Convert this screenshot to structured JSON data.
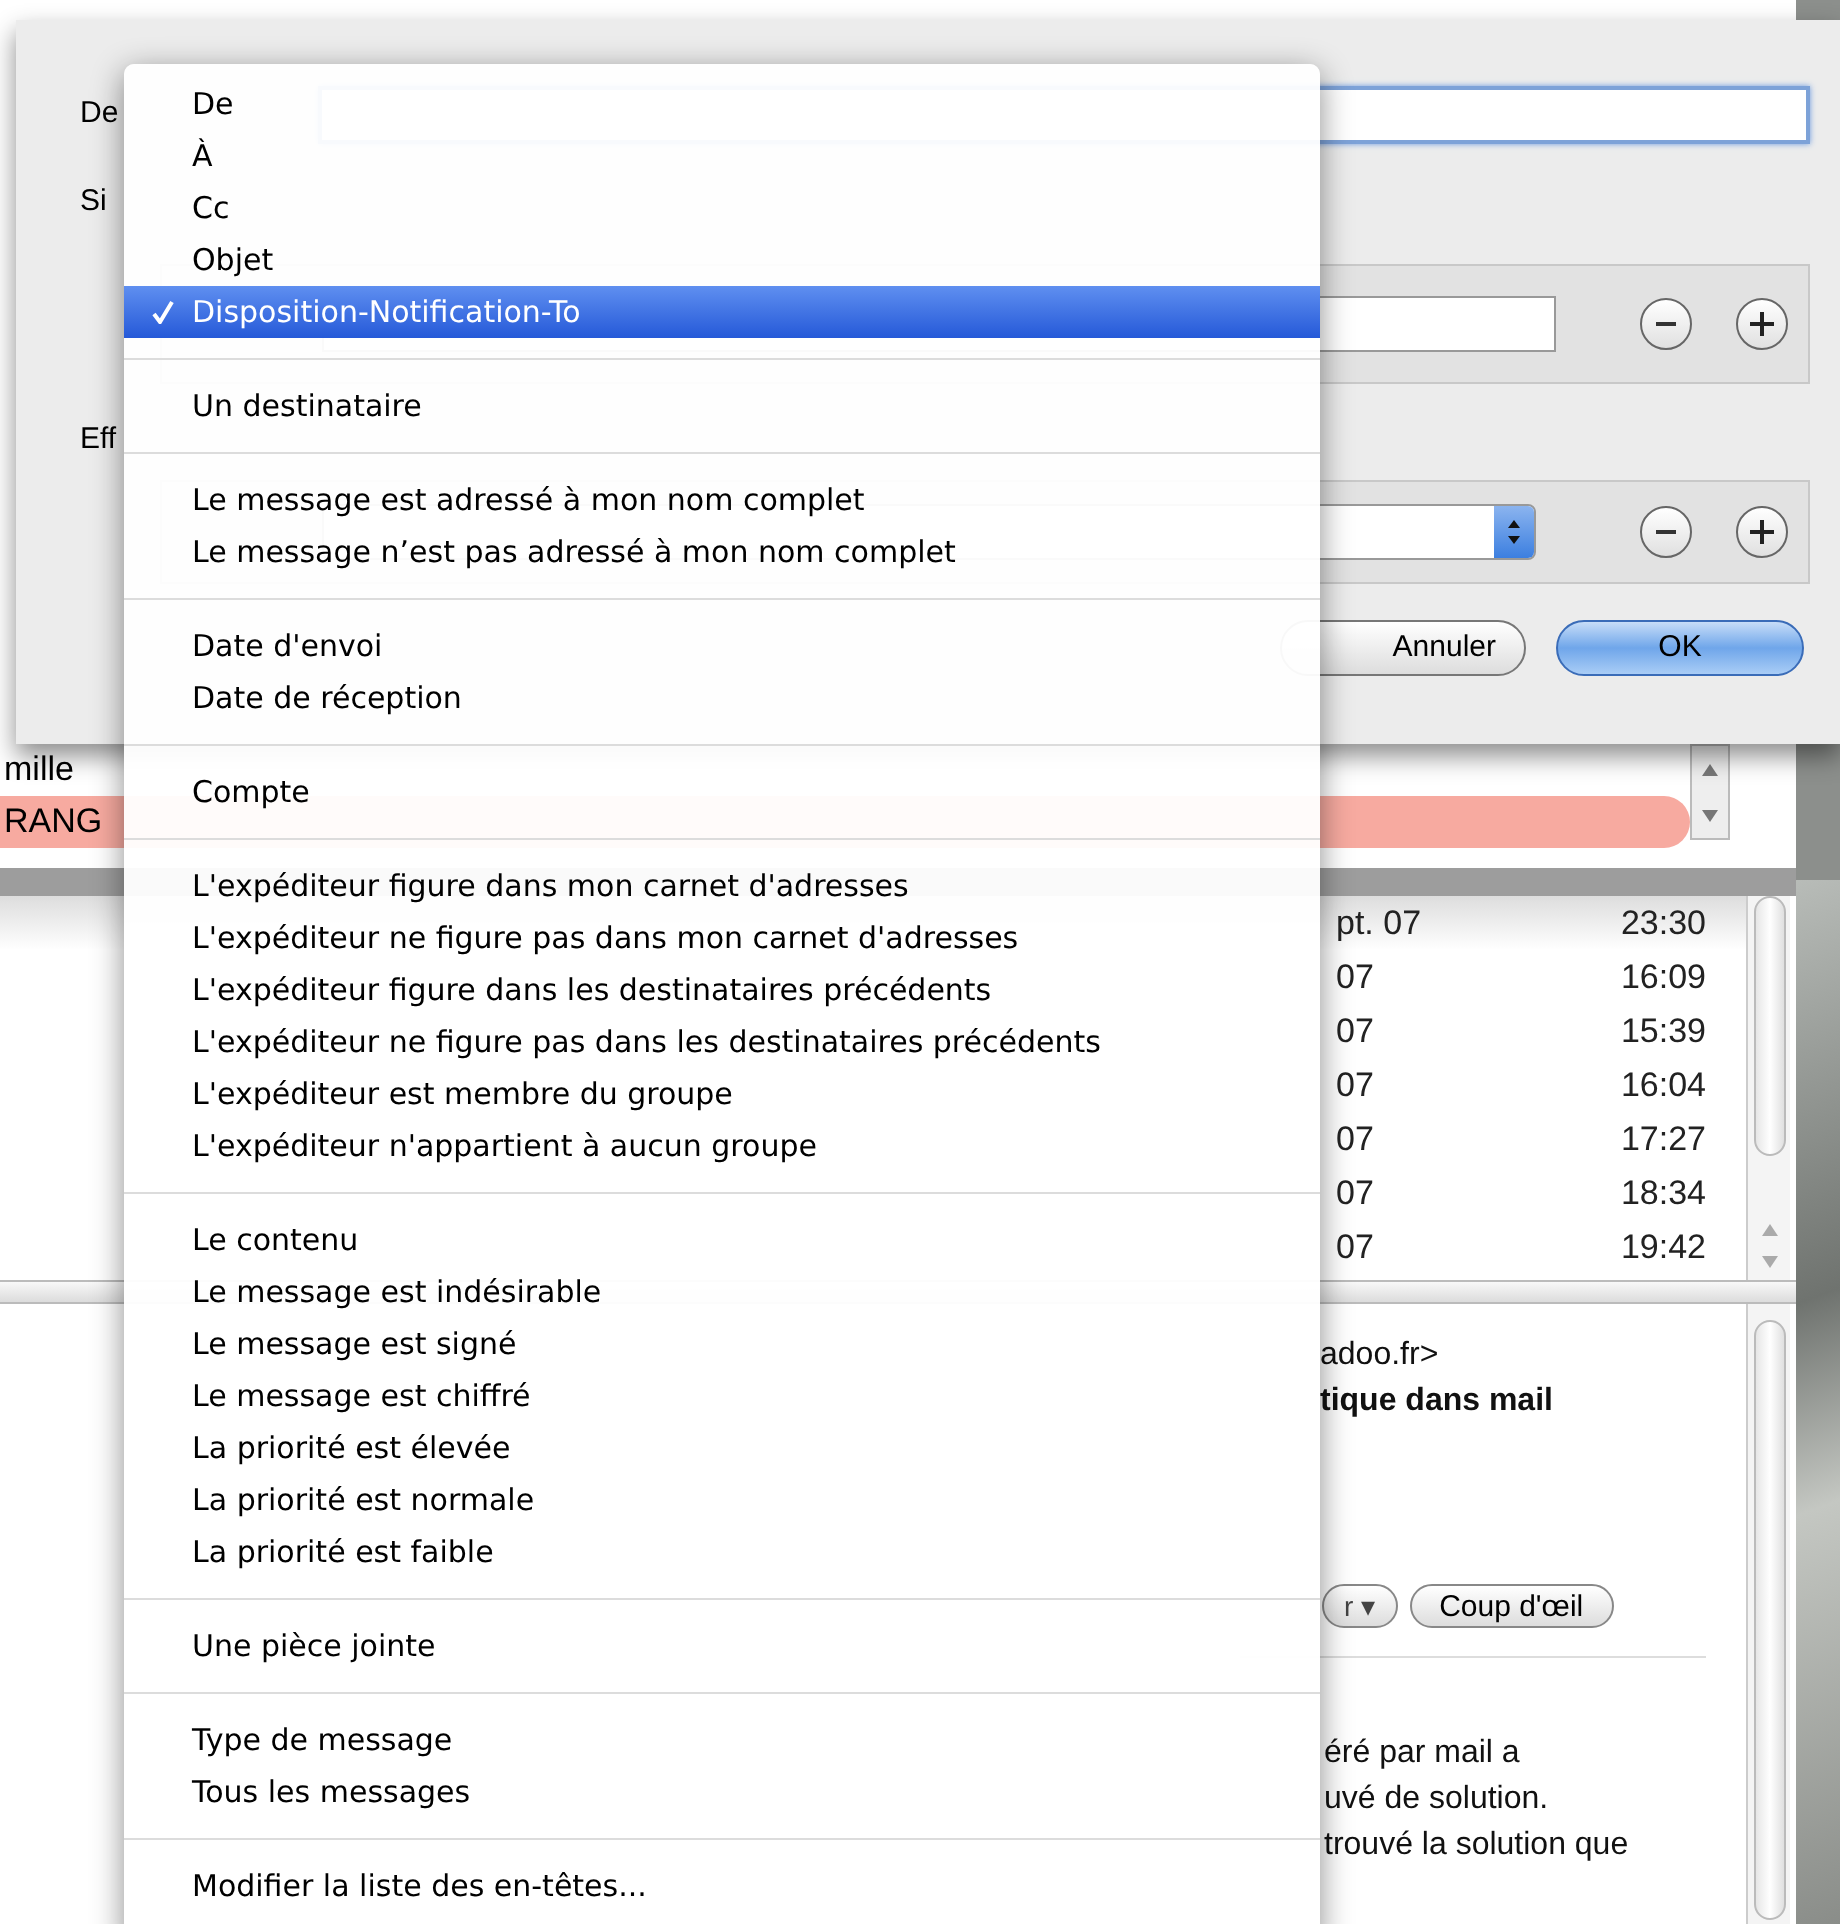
{
  "dialog": {
    "labels": [
      "De",
      "Si",
      "Eff"
    ],
    "buttons": [
      {
        "label": "Annuler",
        "kind": "cancel"
      },
      {
        "label": "OK",
        "kind": "default"
      }
    ]
  },
  "mail_list": [
    {
      "text": "mille",
      "color": "#ffffff"
    },
    {
      "text": "RANG",
      "color": "#f7aaa0"
    }
  ],
  "messages": [
    {
      "date": "pt. 07",
      "time": "23:30"
    },
    {
      "date": "07",
      "time": "16:09"
    },
    {
      "date": "07",
      "time": "15:39"
    },
    {
      "date": "07",
      "time": "16:04"
    },
    {
      "date": "07",
      "time": "17:27"
    },
    {
      "date": "07",
      "time": "18:34"
    },
    {
      "date": "07",
      "time": "19:42"
    }
  ],
  "preview": {
    "header_lines": [
      {
        "text": "adoo.fr>",
        "bold": false
      },
      {
        "text": "tique dans mail",
        "bold": true
      }
    ],
    "attachment_buttons": [
      {
        "label": "r ▾",
        "kind": "menu"
      },
      {
        "label": "Coup d'œil",
        "kind": "plain"
      }
    ],
    "body_lines": [
      "éré par mail a",
      "uvé de solution.",
      "trouvé la solution que"
    ]
  },
  "menu": {
    "sections": [
      [
        {
          "label": "De",
          "selected": false
        },
        {
          "label": "À",
          "selected": false
        },
        {
          "label": "Cc",
          "selected": false
        },
        {
          "label": "Objet",
          "selected": false
        },
        {
          "label": "Disposition-Notification-To",
          "selected": true
        }
      ],
      [
        {
          "label": "Un destinataire",
          "selected": false
        }
      ],
      [
        {
          "label": "Le message est adressé à mon nom complet",
          "selected": false
        },
        {
          "label": "Le message n’est pas adressé à mon nom complet",
          "selected": false
        }
      ],
      [
        {
          "label": "Date d'envoi",
          "selected": false
        },
        {
          "label": "Date de réception",
          "selected": false
        }
      ],
      [
        {
          "label": "Compte",
          "selected": false
        }
      ],
      [
        {
          "label": "L'expéditeur figure dans mon carnet d'adresses",
          "selected": false
        },
        {
          "label": "L'expéditeur ne figure pas dans mon carnet d'adresses",
          "selected": false
        },
        {
          "label": "L'expéditeur figure dans les destinataires précédents",
          "selected": false
        },
        {
          "label": "L'expéditeur ne figure pas dans les destinataires précédents",
          "selected": false
        },
        {
          "label": "L'expéditeur est membre du groupe",
          "selected": false
        },
        {
          "label": "L'expéditeur n'appartient à aucun groupe",
          "selected": false
        }
      ],
      [
        {
          "label": "Le contenu",
          "selected": false
        },
        {
          "label": "Le message est indésirable",
          "selected": false
        },
        {
          "label": "Le message est signé",
          "selected": false
        },
        {
          "label": "Le message est chiffré",
          "selected": false
        },
        {
          "label": "La priorité est élevée",
          "selected": false
        },
        {
          "label": "La priorité est normale",
          "selected": false
        },
        {
          "label": "La priorité est faible",
          "selected": false
        }
      ],
      [
        {
          "label": "Une pièce jointe",
          "selected": false
        }
      ],
      [
        {
          "label": "Type de message",
          "selected": false
        },
        {
          "label": "Tous les messages",
          "selected": false
        }
      ],
      [
        {
          "label": "Modifier la liste des en-têtes...",
          "selected": false
        }
      ]
    ]
  }
}
